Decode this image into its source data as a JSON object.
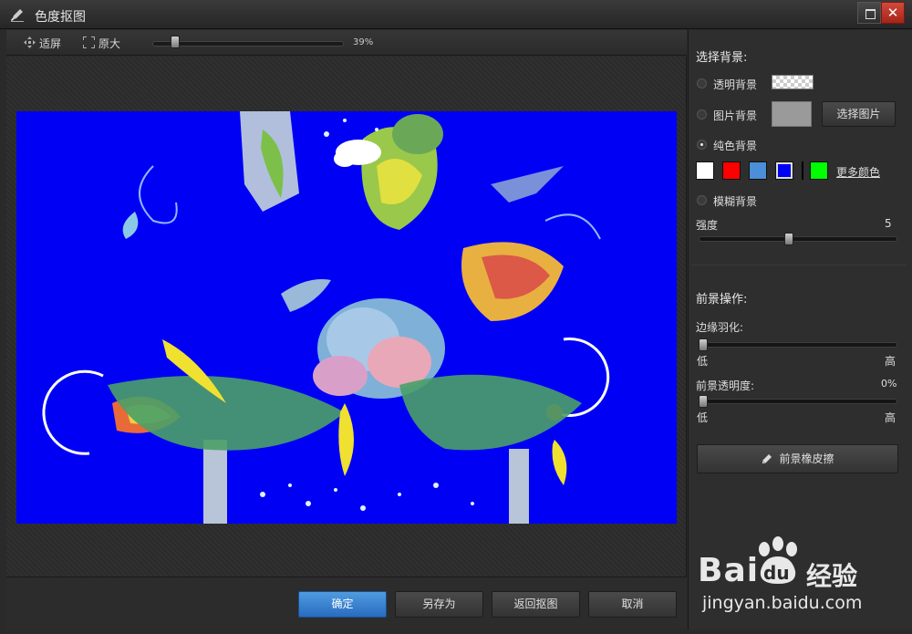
{
  "window": {
    "title": "色度抠图",
    "close_glyph": "✕"
  },
  "toolbar": {
    "fit_label": "适屏",
    "original_label": "原大",
    "zoom_percent": "39%",
    "zoom_fraction": 0.1
  },
  "background": {
    "heading": "选择背景:",
    "transparent_label": "透明背景",
    "image_label": "图片背景",
    "choose_image_label": "选择图片",
    "solid_label": "纯色背景",
    "selected_option": "solid",
    "colors": [
      "#ffffff",
      "#ff0000",
      "#4a8fd8",
      "#0000f5",
      "#000000",
      "#00ff00"
    ],
    "selected_color": "#0000f5",
    "more_colors_label": "更多颜色",
    "blur_label": "模糊背景",
    "strength_label": "强度",
    "strength_value": "5",
    "strength_fraction": 0.45
  },
  "foreground": {
    "heading": "前景操作:",
    "feather_label": "边缘羽化:",
    "feather_low": "低",
    "feather_high": "高",
    "feather_fraction": 0.0,
    "opacity_label": "前景透明度:",
    "opacity_value": "0%",
    "opacity_low": "低",
    "opacity_high": "高",
    "opacity_fraction": 0.0,
    "eraser_label": "前景橡皮擦"
  },
  "actions": {
    "ok_label": "确定",
    "save_as_label": "另存为",
    "back_label": "返回抠图",
    "cancel_label": "取消"
  },
  "watermark": {
    "brand": "Bai",
    "paw_text": "du",
    "cn": "经验",
    "url": "jingyan.baidu.com"
  }
}
